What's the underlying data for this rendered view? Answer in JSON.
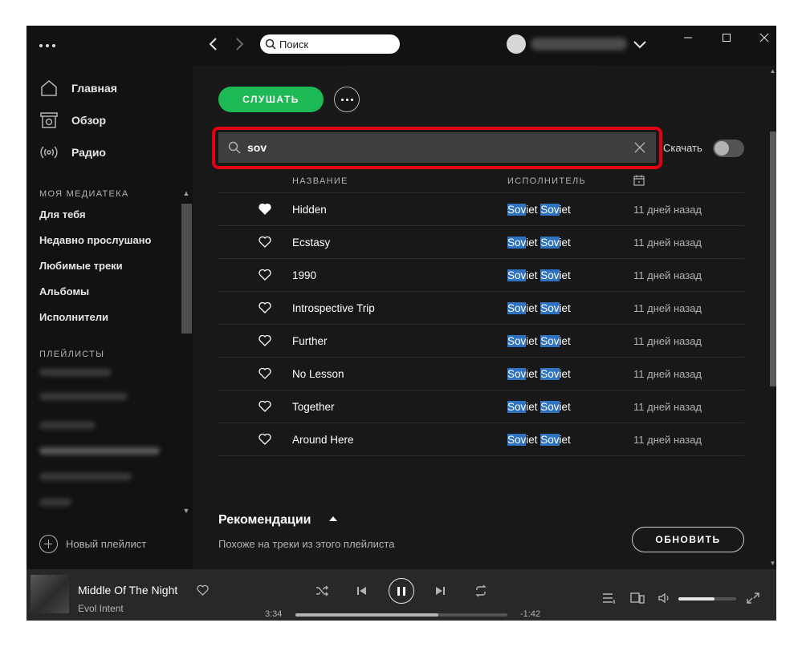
{
  "sidebar": {
    "nav": [
      {
        "label": "Главная",
        "icon": "home-icon"
      },
      {
        "label": "Обзор",
        "icon": "browse-icon"
      },
      {
        "label": "Радио",
        "icon": "radio-icon"
      }
    ],
    "library_title": "МОЯ МЕДИАТЕКА",
    "library_items": [
      "Для тебя",
      "Недавно прослушано",
      "Любимые треки",
      "Альбомы",
      "Исполнители"
    ],
    "playlists_title": "ПЛЕЙЛИСТЫ",
    "new_playlist": "Новый плейлист"
  },
  "topbar": {
    "search_placeholder": "Поиск"
  },
  "playlist": {
    "play_label": "СЛУШАТЬ",
    "filter_value": "sov",
    "download_label": "Скачать",
    "download_enabled": false
  },
  "table": {
    "headers": {
      "title": "НАЗВАНИЕ",
      "artist": "ИСПОЛНИТЕЛЬ"
    },
    "highlight_query": "Sov",
    "rows": [
      {
        "title": "Hidden",
        "artist_parts": [
          "Sov",
          "iet ",
          "Sov",
          "iet"
        ],
        "added": "11 дней назад",
        "liked": true
      },
      {
        "title": "Ecstasy",
        "artist_parts": [
          "Sov",
          "iet ",
          "Sov",
          "iet"
        ],
        "added": "11 дней назад",
        "liked": false
      },
      {
        "title": "1990",
        "artist_parts": [
          "Sov",
          "iet ",
          "Sov",
          "iet"
        ],
        "added": "11 дней назад",
        "liked": false
      },
      {
        "title": "Introspective Trip",
        "artist_parts": [
          "Sov",
          "iet ",
          "Sov",
          "iet"
        ],
        "added": "11 дней назад",
        "liked": false
      },
      {
        "title": "Further",
        "artist_parts": [
          "Sov",
          "iet ",
          "Sov",
          "iet"
        ],
        "added": "11 дней назад",
        "liked": false
      },
      {
        "title": "No Lesson",
        "artist_parts": [
          "Sov",
          "iet ",
          "Sov",
          "iet"
        ],
        "added": "11 дней назад",
        "liked": false
      },
      {
        "title": "Together",
        "artist_parts": [
          "Sov",
          "iet ",
          "Sov",
          "iet"
        ],
        "added": "11 дней назад",
        "liked": false
      },
      {
        "title": "Around Here",
        "artist_parts": [
          "Sov",
          "iet ",
          "Sov",
          "iet"
        ],
        "added": "11 дней назад",
        "liked": false
      }
    ]
  },
  "recommendations": {
    "title": "Рекомендации",
    "subtitle": "Похоже на треки из этого плейлиста",
    "refresh_label": "ОБНОВИТЬ"
  },
  "player": {
    "track_title": "Middle Of The Night",
    "track_artist": "Evol Intent",
    "elapsed": "3:34",
    "remaining": "-1:42",
    "progress_fraction": 0.675,
    "volume_fraction": 0.63
  },
  "colors": {
    "accent_green": "#1db954",
    "highlight_blue": "#2e73c2",
    "annotation_red": "#e30016"
  }
}
